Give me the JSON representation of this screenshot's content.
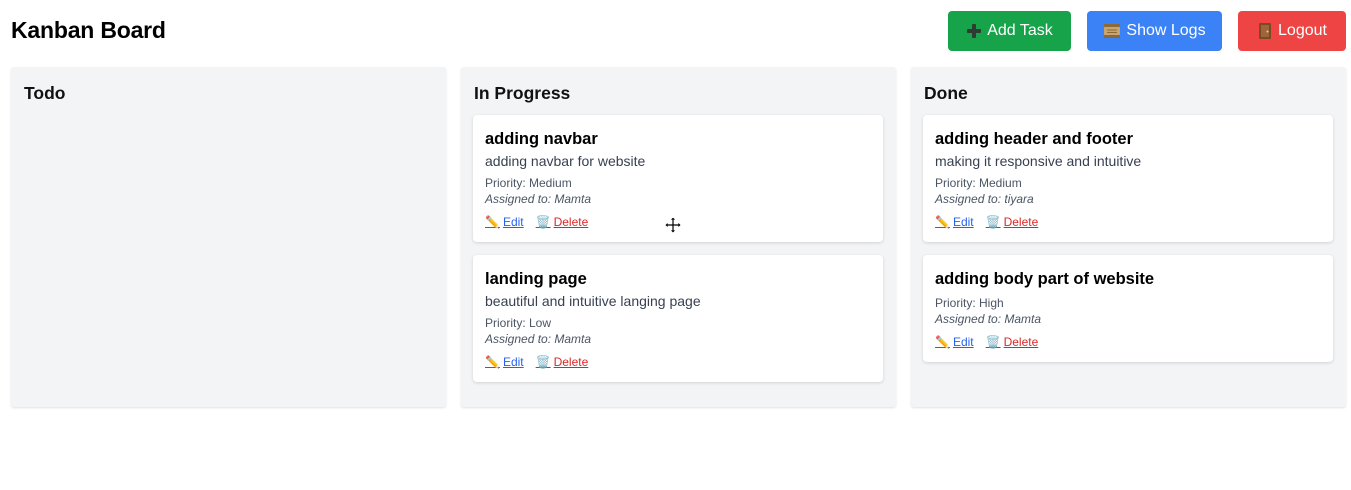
{
  "header": {
    "title": "Kanban Board",
    "add_task": "Add Task",
    "show_logs": "Show Logs",
    "logout": "Logout",
    "icons": {
      "add": "plus-icon",
      "logs": "scroll-icon",
      "logout": "door-icon"
    }
  },
  "columns": [
    {
      "title": "Todo",
      "cards": []
    },
    {
      "title": "In Progress",
      "cards": [
        {
          "title": "adding navbar",
          "description": "adding navbar for website",
          "priority": "Priority: Medium",
          "assigned": "Assigned to: Mamta",
          "edit": "Edit",
          "delete": "Delete"
        },
        {
          "title": "landing page",
          "description": "beautiful and intuitive langing page",
          "priority": "Priority: Low",
          "assigned": "Assigned to: Mamta",
          "edit": "Edit",
          "delete": "Delete"
        }
      ]
    },
    {
      "title": "Done",
      "cards": [
        {
          "title": "adding header and footer",
          "description": "making it responsive and intuitive",
          "priority": "Priority: Medium",
          "assigned": "Assigned to: tiyara",
          "edit": "Edit",
          "delete": "Delete"
        },
        {
          "title": "adding body part of website",
          "description": "",
          "priority": "Priority: High",
          "assigned": "Assigned to: Mamta",
          "edit": "Edit",
          "delete": "Delete"
        }
      ]
    }
  ],
  "colors": {
    "add": "#16a34a",
    "logs": "#3b82f6",
    "logout": "#ef4444",
    "column_bg": "#f3f4f6",
    "edit_link": "#2563eb",
    "delete_link": "#dc2626"
  }
}
